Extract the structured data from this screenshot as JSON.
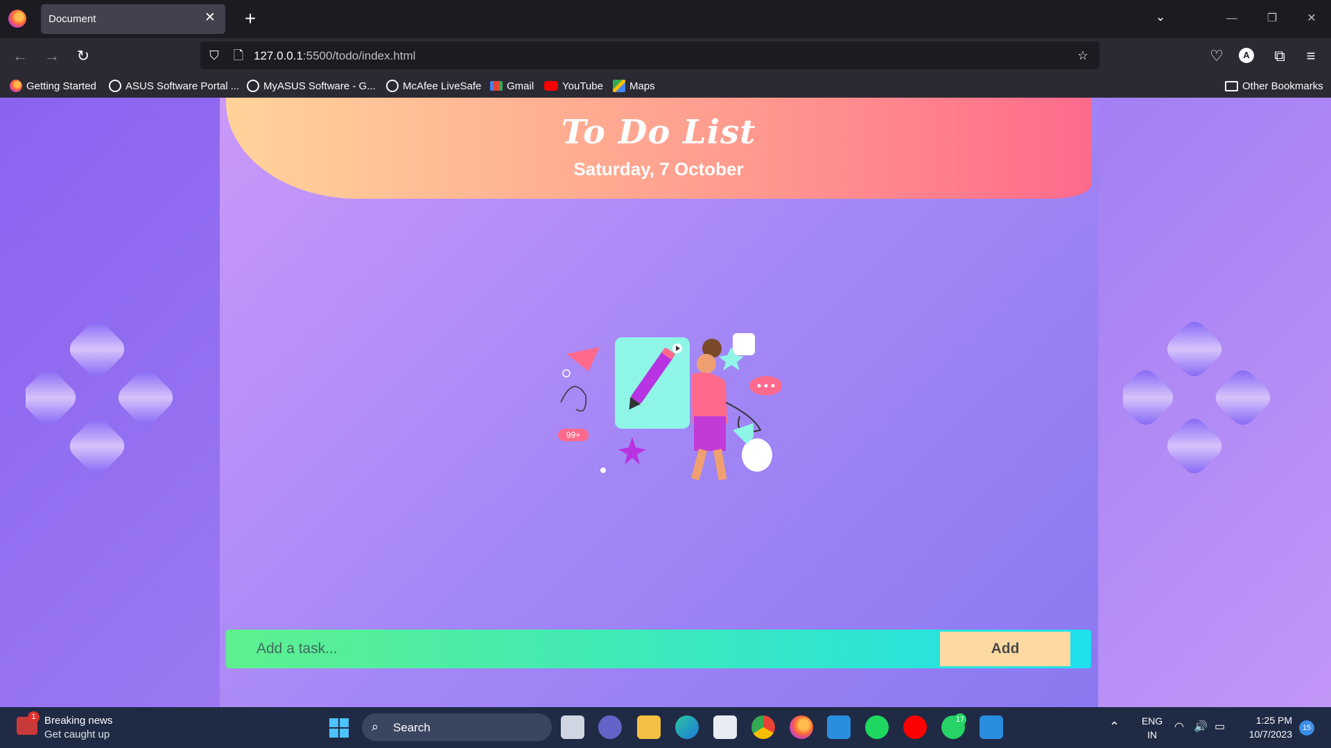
{
  "browser": {
    "tab_title": "Document",
    "url_host": "127.0.0.1",
    "url_rest": ":5500/todo/index.html",
    "bookmarks": [
      "Getting Started",
      "ASUS Software Portal ...",
      "MyASUS Software - G...",
      "McAfee LiveSafe",
      "Gmail",
      "YouTube",
      "Maps"
    ],
    "other_bookmarks": "Other Bookmarks",
    "profile_initial": "A"
  },
  "page": {
    "title": "To Do List",
    "date": "Saturday, 7 October",
    "task_placeholder": "Add a task...",
    "add_label": "Add",
    "illustration_badge": "99+"
  },
  "taskbar": {
    "news_title": "Breaking news",
    "news_sub": "Get caught up",
    "news_badge": "1",
    "search_label": "Search",
    "lang_1": "ENG",
    "lang_2": "IN",
    "time": "1:25 PM",
    "date": "10/7/2023",
    "whatsapp_badge": "17",
    "notification_count": "15"
  },
  "colors": {
    "header_gradient": [
      "#ffd39a",
      "#ff6a8c"
    ],
    "task_gradient": [
      "#5ef08e",
      "#1ee0ee"
    ],
    "add_button": "#ffd9a2"
  }
}
